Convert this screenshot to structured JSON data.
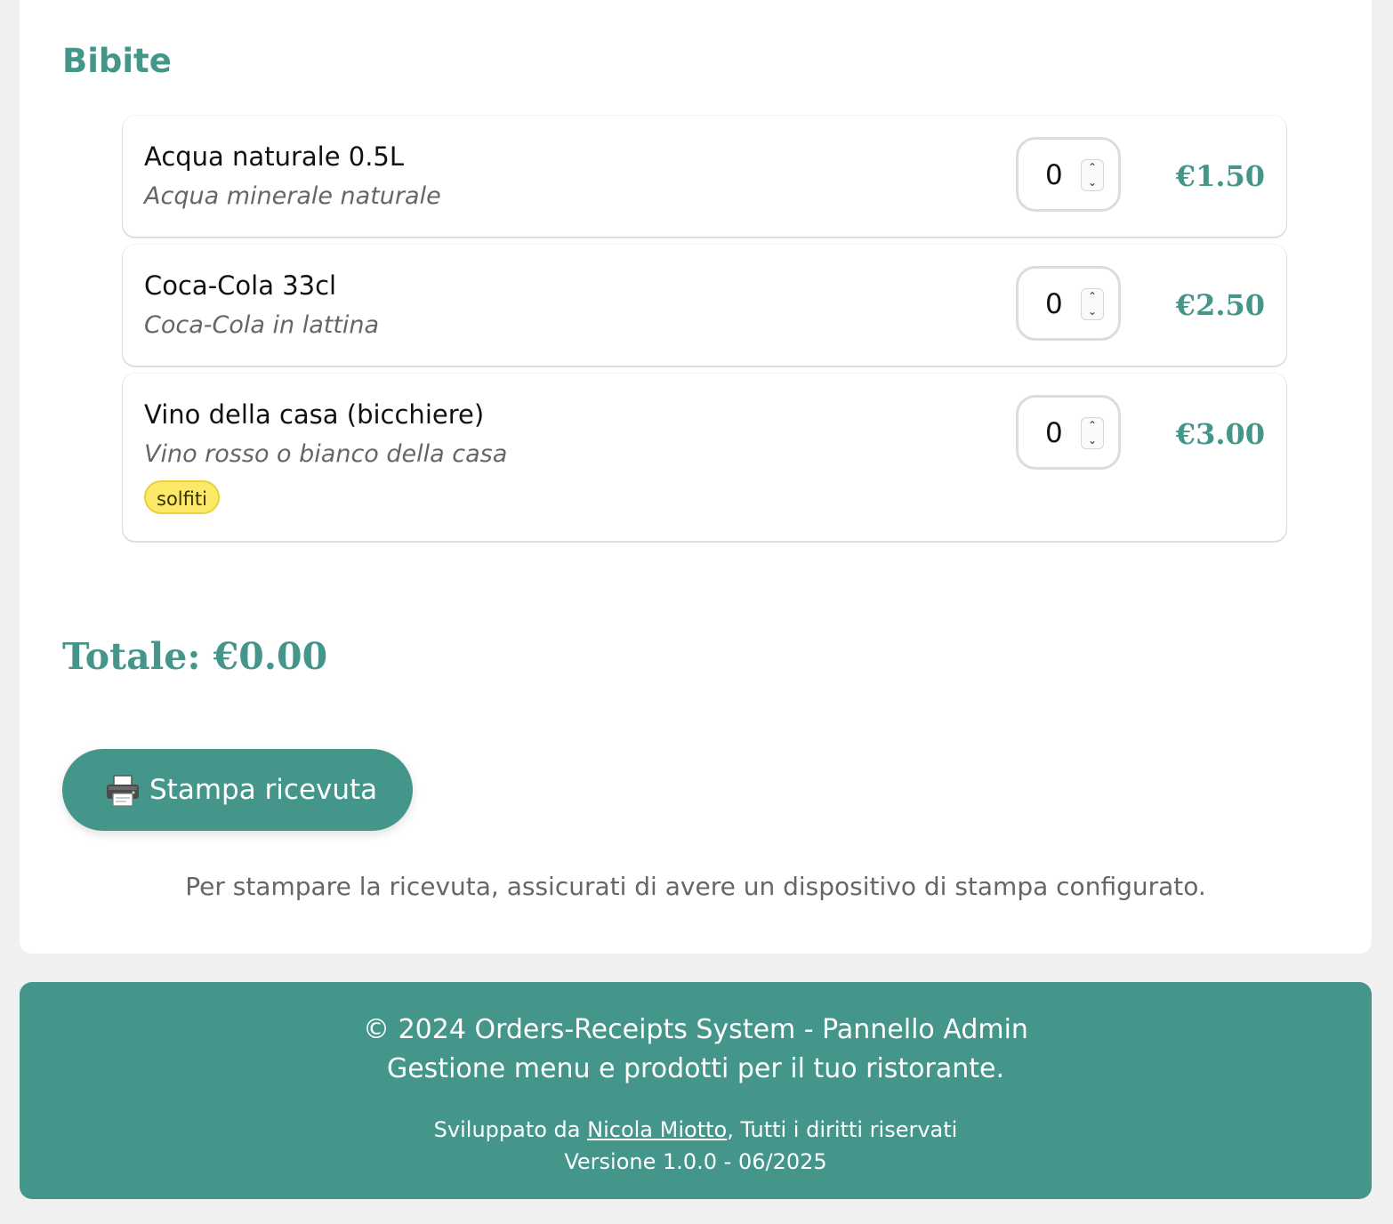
{
  "section": {
    "title": "Bibite"
  },
  "items": [
    {
      "name": "Acqua naturale 0.5L",
      "description": "Acqua minerale naturale",
      "quantity": "0",
      "price": "€1.50"
    },
    {
      "name": "Coca-Cola 33cl",
      "description": "Coca-Cola in lattina",
      "quantity": "0",
      "price": "€2.50"
    },
    {
      "name": "Vino della casa (bicchiere)",
      "description": "Vino rosso o bianco della casa",
      "quantity": "0",
      "price": "€3.00",
      "allergen": "solfiti"
    }
  ],
  "total": {
    "label": "Totale: €0.00"
  },
  "print": {
    "icon": "printer-icon",
    "label": "Stampa ricevuta",
    "note": "Per stampare la ricevuta, assicurati di avere un dispositivo di stampa configurato."
  },
  "footer": {
    "line1": "© 2024 Orders-Receipts System - Pannello Admin",
    "line2": "Gestione menu e prodotti per il tuo ristorante.",
    "developed_prefix": "Sviluppato da ",
    "developer_name": "Nicola Miotto",
    "developed_suffix": ", Tutti i diritti riservati",
    "version": "Versione 1.0.0 - 06/2025"
  },
  "colors": {
    "accent": "#44968a",
    "background": "#f0f0f0",
    "allergen_badge": "#fde968"
  }
}
